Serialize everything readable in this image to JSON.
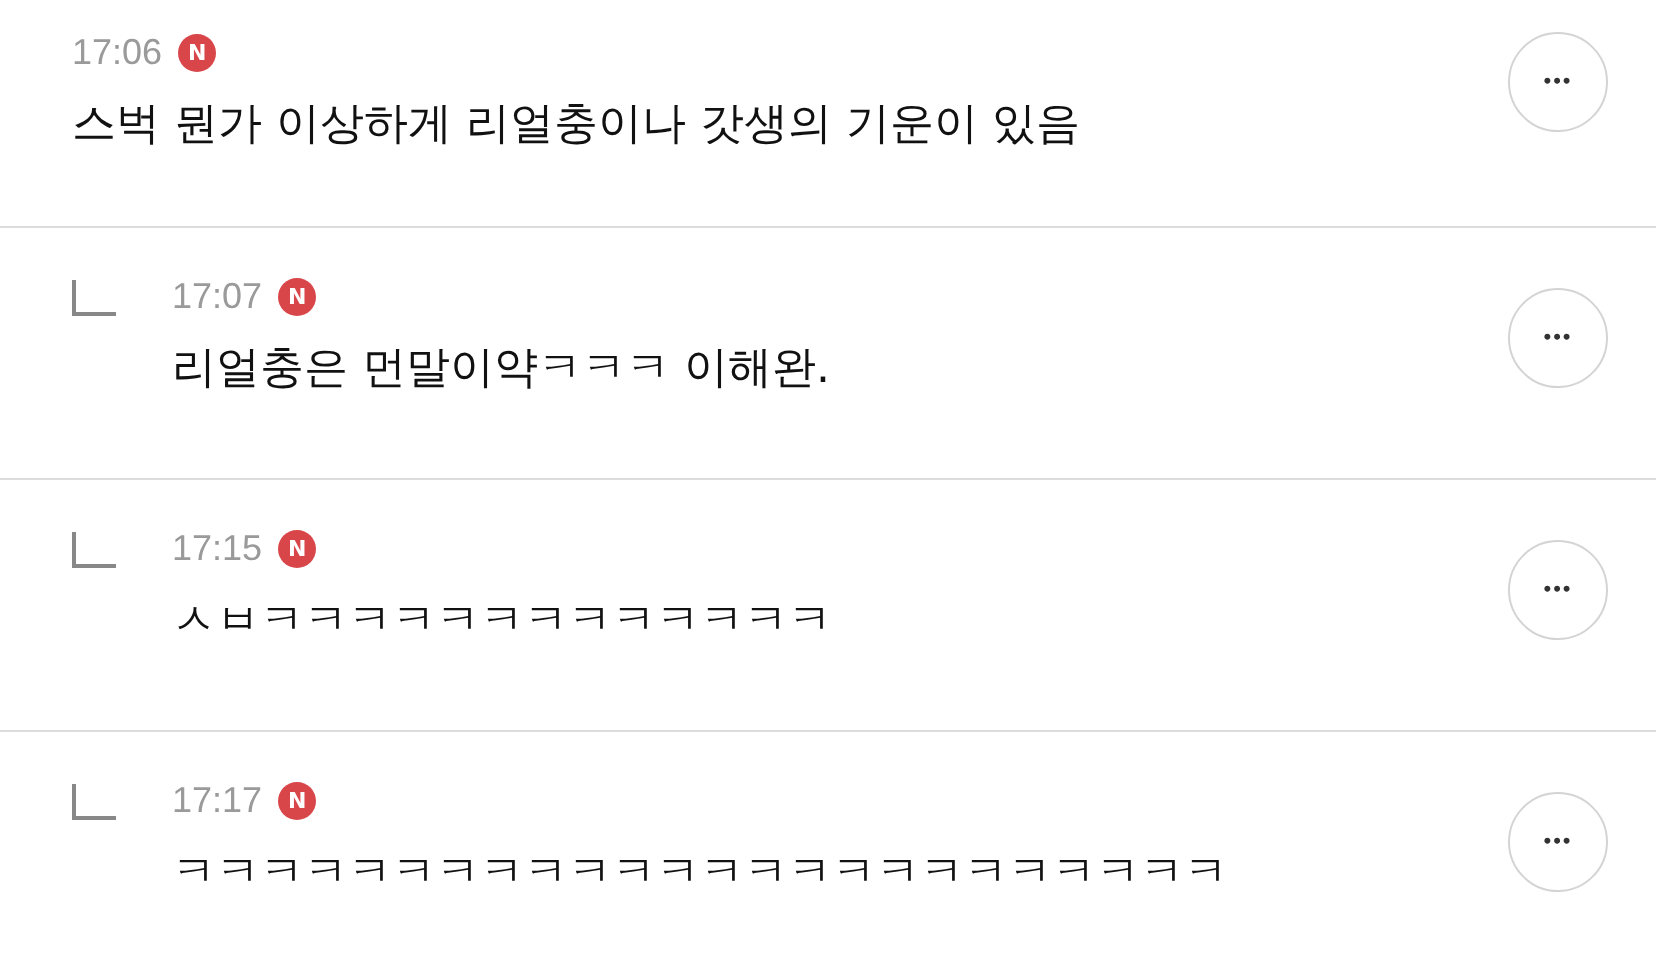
{
  "comments": [
    {
      "kind": "comment",
      "time": "17:06",
      "badge": "N",
      "text": "스벅 뭔가 이상하게 리얼충이나 갓생의 기운이 있음",
      "more": "•••"
    },
    {
      "kind": "reply",
      "time": "17:07",
      "badge": "N",
      "text": "리얼충은 먼말이약ㅋㅋㅋ 이해완.",
      "more": "•••"
    },
    {
      "kind": "reply",
      "time": "17:15",
      "badge": "N",
      "text": "ㅅㅂㅋㅋㅋㅋㅋㅋㅋㅋㅋㅋㅋㅋㅋ",
      "more": "•••"
    },
    {
      "kind": "reply",
      "time": "17:17",
      "badge": "N",
      "text": "ㅋㅋㅋㅋㅋㅋㅋㅋㅋㅋㅋㅋㅋㅋㅋㅋㅋㅋㅋㅋㅋㅋㅋㅋ",
      "more": "•••"
    }
  ]
}
